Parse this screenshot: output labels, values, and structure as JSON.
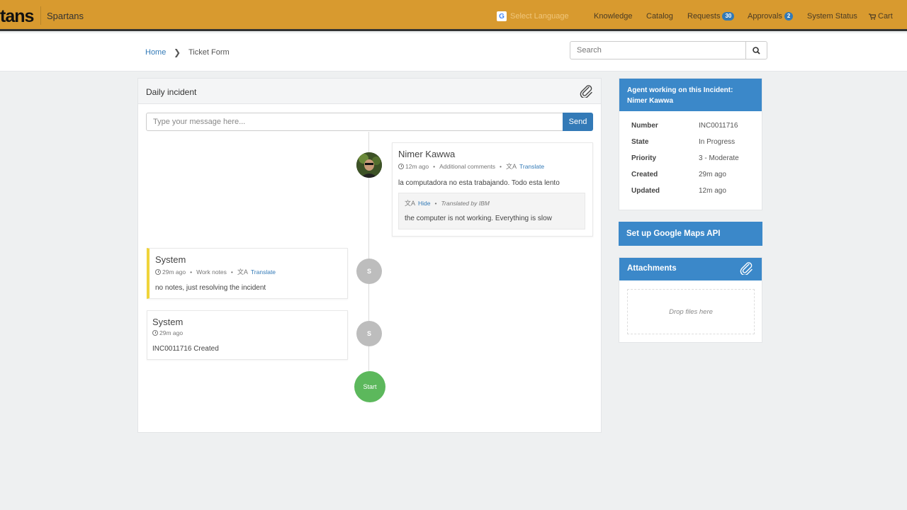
{
  "header": {
    "brand_fragment": "tans",
    "brand_name": "Spartans",
    "language_label": "Select Language",
    "nav": {
      "knowledge": "Knowledge",
      "catalog": "Catalog",
      "requests": "Requests",
      "requests_count": "30",
      "approvals": "Approvals",
      "approvals_count": "2",
      "system_status": "System Status",
      "cart": "Cart"
    },
    "bar_color": "#d89a2f"
  },
  "breadcrumb": {
    "home": "Home",
    "current": "Ticket Form"
  },
  "search": {
    "placeholder": "Search"
  },
  "ticket": {
    "title": "Daily incident",
    "message_placeholder": "Type your message here...",
    "send_label": "Send",
    "entries": [
      {
        "author": "Nimer Kawwa",
        "time": "12m ago",
        "type": "Additional comments",
        "translate_label": "Translate",
        "text": "la computadora no esta trabajando. Todo esta lento",
        "translation": {
          "hide_label": "Hide",
          "by": "Translated by IBM",
          "text": "the computer is not working. Everything is slow"
        }
      },
      {
        "author": "System",
        "time": "29m ago",
        "type": "Work notes",
        "translate_label": "Translate",
        "text": "no notes, just resolving the incident",
        "node_label": "S",
        "accent_color": "#f0d43a"
      },
      {
        "author": "System",
        "time": "29m ago",
        "text": "INC0011716 Created",
        "node_label": "S"
      }
    ],
    "start_label": "Start"
  },
  "agent": {
    "heading": "Agent working on this Incident:",
    "name": "Nimer Kawwa",
    "fields": [
      {
        "label": "Number",
        "value": "INC0011716"
      },
      {
        "label": "State",
        "value": "In Progress"
      },
      {
        "label": "Priority",
        "value": "3 - Moderate"
      },
      {
        "label": "Created",
        "value": "29m ago"
      },
      {
        "label": "Updated",
        "value": "12m ago"
      }
    ]
  },
  "maps_button": "Set up Google Maps API",
  "attachments": {
    "title": "Attachments",
    "drop_text": "Drop files here"
  }
}
